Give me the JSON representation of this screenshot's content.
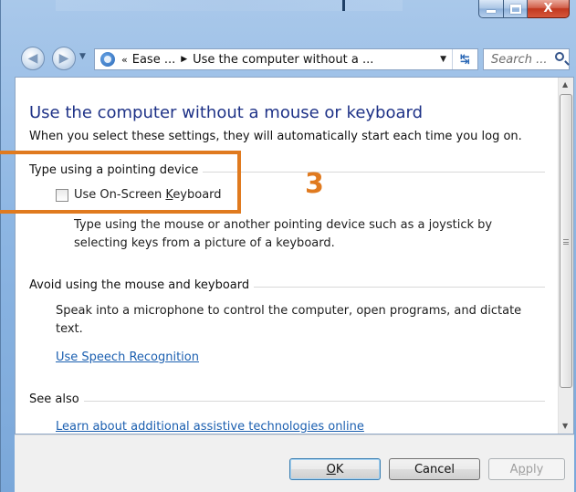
{
  "window": {
    "title": "",
    "caption_buttons": {
      "minimize": "minimize",
      "maximize": "maximize",
      "close": "X"
    }
  },
  "nav": {
    "breadcrumb_prefix": "«",
    "breadcrumbs": [
      "Ease ...",
      "Use the computer without a ..."
    ],
    "breadcrumb_separator": "▶",
    "search_placeholder": "Search ..."
  },
  "page": {
    "title": "Use the computer without a mouse or keyboard",
    "subtitle": "When you select these settings, they will automatically start each time you log on."
  },
  "sections": {
    "pointing": {
      "header": "Type using a pointing device",
      "checkbox_label_pre": "Use On-Screen ",
      "checkbox_label_underlined": "K",
      "checkbox_label_post": "eyboard",
      "checked": false,
      "description": "Type using the mouse or another pointing device such as a joystick by selecting keys from a picture of a keyboard."
    },
    "avoid": {
      "header": "Avoid using the mouse and keyboard",
      "description": "Speak into a microphone to control the computer, open programs, and dictate text.",
      "link_underlined": "U",
      "link_rest": "se Speech Recognition"
    },
    "see_also": {
      "header": "See also",
      "link": "Learn about additional assistive technologies online"
    }
  },
  "buttons": {
    "ok_underlined": "O",
    "ok_rest": "K",
    "cancel": "Cancel",
    "apply_pre": "A",
    "apply_underlined": "p",
    "apply_post": "ply"
  },
  "annotation": {
    "number": "3",
    "color": "#e07a1f"
  },
  "colors": {
    "title_blue": "#1e3287",
    "link_blue": "#1b5fb0",
    "close_red": "#c1381f"
  }
}
